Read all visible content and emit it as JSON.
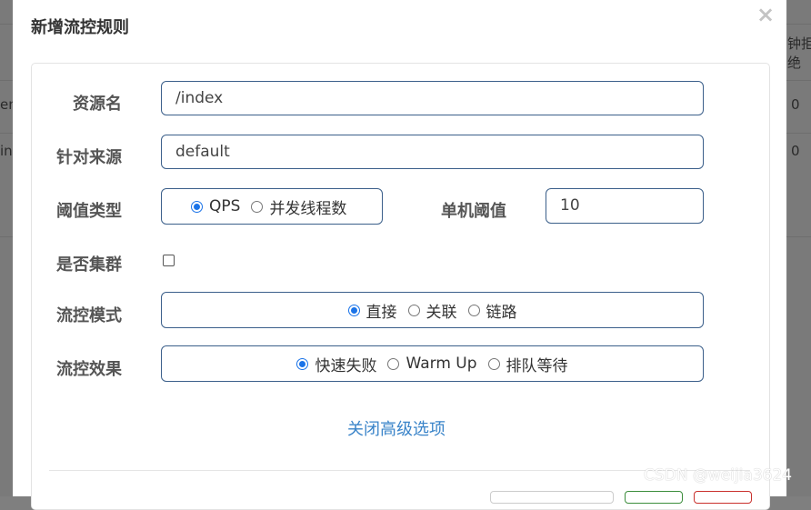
{
  "background": {
    "header_fragment": "钟拒\n绝",
    "left_row1": "en",
    "left_row2": "ind",
    "right_row1": "0",
    "right_row2": "0"
  },
  "dialog": {
    "title": "新增流控规则",
    "close_icon": "×",
    "fields": {
      "resource_label": "资源名",
      "resource_value": "/index",
      "origin_label": "针对来源",
      "origin_value": "default",
      "threshold_type_label": "阈值类型",
      "threshold_type_options": [
        "QPS",
        "并发线程数"
      ],
      "threshold_type_selected": "QPS",
      "single_threshold_label": "单机阈值",
      "single_threshold_value": "10",
      "cluster_label": "是否集群",
      "cluster_checked": false,
      "mode_label": "流控模式",
      "mode_options": [
        "直接",
        "关联",
        "链路"
      ],
      "mode_selected": "直接",
      "effect_label": "流控效果",
      "effect_options": [
        "快速失败",
        "Warm Up",
        "排队等待"
      ],
      "effect_selected": "快速失败"
    },
    "advanced_link": "关闭高级选项"
  },
  "watermark": "CSDN @weijia3624",
  "colors": {
    "accent": "#1a73e8",
    "link": "#3a84c9",
    "input_border": "#3b5f8a",
    "overlay": "#7f7f7f"
  }
}
